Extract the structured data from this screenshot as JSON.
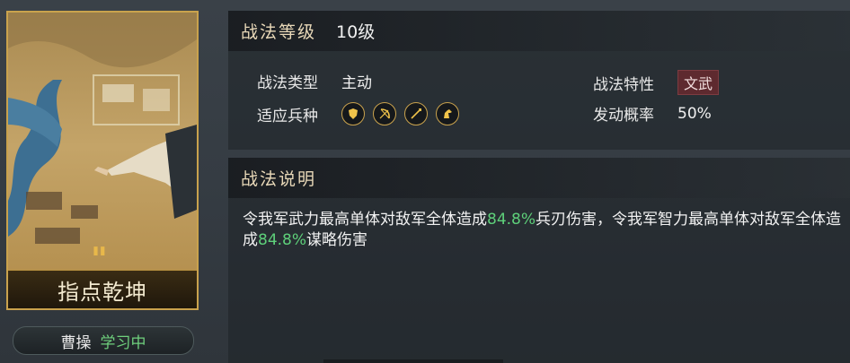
{
  "card": {
    "skill_name": "指点乾坤",
    "owner_name": "曹操",
    "owner_status": "学习中"
  },
  "level_panel": {
    "title": "战法等级",
    "level": "10级",
    "type_label": "战法类型",
    "type_value": "主动",
    "trait_label": "战法特性",
    "trait_value": "文武",
    "troops_label": "适应兵种",
    "troop_icons": [
      "shield-icon",
      "bow-icon",
      "spear-icon",
      "horse-icon"
    ],
    "rate_label": "发动概率",
    "rate_value": "50%"
  },
  "desc_panel": {
    "title": "战法说明",
    "p1": "令我军武力最高单体对敌军全体造成",
    "v1": "84.8%",
    "p2": "兵刃伤害，令我军智力最高单体对敌军全体造成",
    "v2": "84.8%",
    "p3": "谋略伤害"
  },
  "colors": {
    "accent_gold": "#c9a24d",
    "highlight_green": "#5ed07a",
    "tag_red": "#5e2a2f"
  }
}
